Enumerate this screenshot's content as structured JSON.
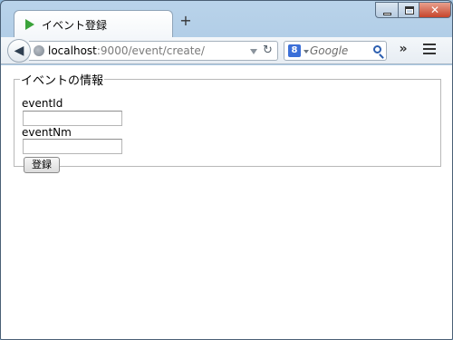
{
  "browser": {
    "tab_title": "イベント登録",
    "new_tab_label": "+",
    "url_host": "localhost",
    "url_rest": ":9000/event/create/",
    "search_engine_letter": "8",
    "search_placeholder": "Google",
    "overflow_label": "»",
    "close_label": "✕"
  },
  "form": {
    "legend": "イベントの情報",
    "fields": [
      {
        "label": "eventId",
        "value": ""
      },
      {
        "label": "eventNm",
        "value": ""
      }
    ],
    "submit_label": "登録"
  },
  "icons": {
    "tab_icon": "play-triangle-icon",
    "back": "back-arrow-icon",
    "site": "globe-icon",
    "reload": "reload-icon",
    "search": "magnifier-icon",
    "menu": "hamburger-menu-icon"
  },
  "colors": {
    "tab_icon_green": "#3aa33a",
    "window_frame": "#9ebfde",
    "close_button": "#c7452c"
  }
}
